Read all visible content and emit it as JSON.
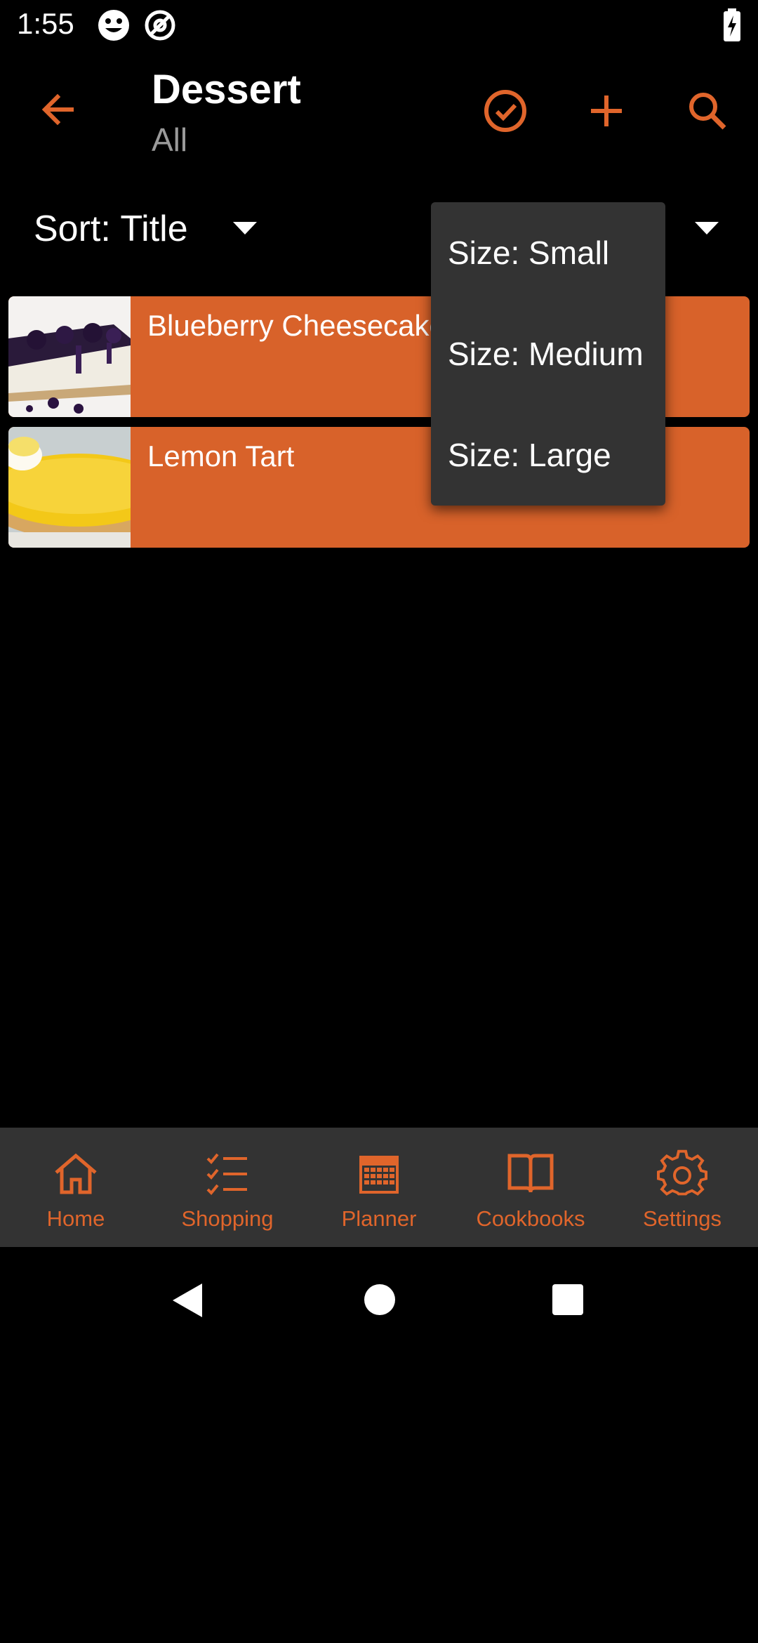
{
  "status_bar": {
    "time": "1:55",
    "icons": [
      "emoji-face-icon",
      "at-sign-icon",
      "battery-charging-icon"
    ]
  },
  "app_bar": {
    "title": "Dessert",
    "subtitle": "All",
    "actions": [
      "back-arrow-icon",
      "check-circle-icon",
      "plus-icon",
      "search-icon"
    ]
  },
  "sort": {
    "label": "Sort: Title"
  },
  "size_dropdown": {
    "options": [
      "Size: Small",
      "Size: Medium",
      "Size: Large"
    ]
  },
  "recipes": [
    {
      "title": "Blueberry Cheesecake",
      "thumb_icon": "cheesecake-photo"
    },
    {
      "title": "Lemon Tart",
      "thumb_icon": "lemon-tart-photo"
    }
  ],
  "bottom_nav": {
    "items": [
      {
        "label": "Home",
        "icon": "home-icon"
      },
      {
        "label": "Shopping",
        "icon": "checklist-icon"
      },
      {
        "label": "Planner",
        "icon": "calendar-icon"
      },
      {
        "label": "Cookbooks",
        "icon": "book-icon"
      },
      {
        "label": "Settings",
        "icon": "gear-icon"
      }
    ]
  },
  "colors": {
    "accent": "#e0652b",
    "card": "#d8622a",
    "menu_bg": "#333333",
    "background": "#000000",
    "subtitle": "#9a9a9a"
  }
}
